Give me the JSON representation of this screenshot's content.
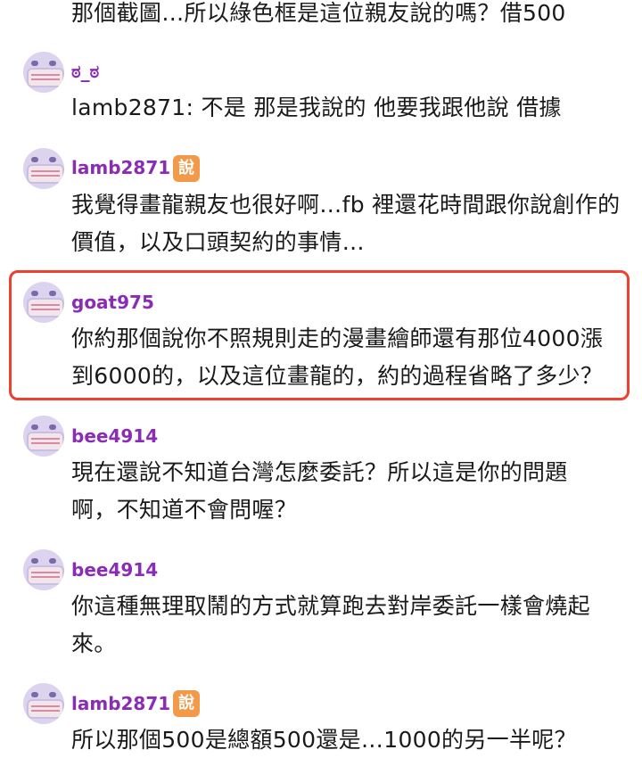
{
  "top_line": "那個截圖…所以綠色框是這位親友說的嗎？借500",
  "comments": [
    {
      "user": "ಠ_ಠ",
      "badge": "",
      "lines": [
        "lamb2871: 不是 那是我說的 他要我跟他說 借據"
      ]
    },
    {
      "user": "lamb2871",
      "badge": "說",
      "lines": [
        "我覺得畫龍親友也很好啊…fb 裡還花時間跟你說創作的",
        "價值，以及口頭契約的事情…"
      ]
    },
    {
      "user": "goat975",
      "badge": "",
      "lines": [
        "你約那個說你不照規則走的漫畫繪師還有那位4000漲",
        "到6000的，以及這位畫龍的，約的過程省略了多少？"
      ]
    },
    {
      "user": "bee4914",
      "badge": "",
      "lines": [
        "現在還說不知道台灣怎麼委託？所以這是你的問題",
        "啊，不知道不會問喔？"
      ]
    },
    {
      "user": "bee4914",
      "badge": "",
      "lines": [
        "你這種無理取鬧的方式就算跑去對岸委託一樣會燒起",
        "來。"
      ]
    },
    {
      "user": "lamb2871",
      "badge": "說",
      "lines": [
        "所以那個500是總額500還是…1000的另一半呢？"
      ]
    }
  ],
  "colors": {
    "username": "#8a2cb5",
    "badge": "#f29a4a",
    "highlight_border": "#ef3f2f"
  },
  "icons": {
    "avatar": "masked-face-avatar-icon"
  }
}
